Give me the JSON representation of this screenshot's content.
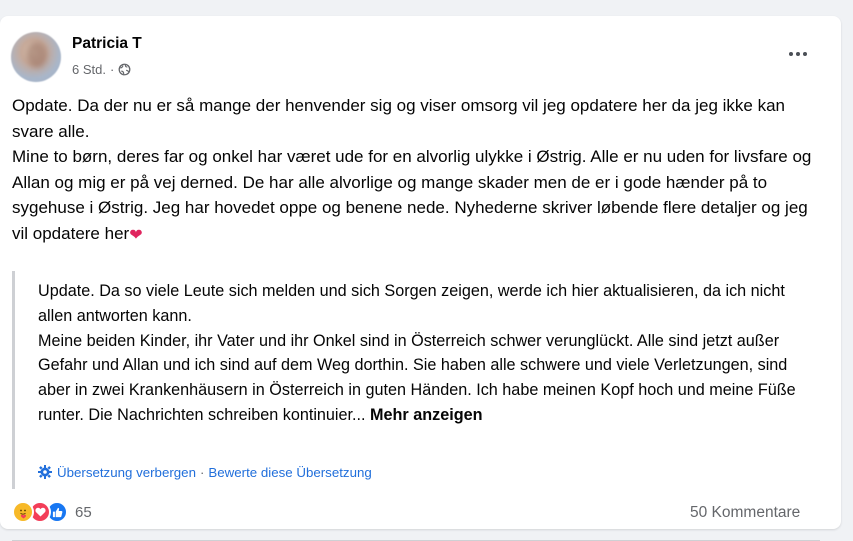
{
  "post": {
    "author": "Patricia T",
    "time": "6 Std.",
    "time_separator": "·",
    "audience_icon": "globe-icon",
    "more_icon": "more-dots-icon",
    "text_lines": [
      "Opdate. Da der nu er så mange der henvender sig og viser omsorg vil jeg opdatere her da jeg ikke kan svare alle.",
      "Mine to børn, deres far og onkel har været ude for en alvorlig ulykke i Østrig. Alle er nu uden for livsfare og Allan og mig er på vej derned. De har alle alvorlige og mange skader men de er i gode hænder på to sygehuse i Østrig. Jeg har hovedet oppe og benene nede. Nyhederne skriver løbende flere detaljer og jeg vil opdatere her"
    ],
    "heart_emoji": "❤"
  },
  "translation": {
    "lines": [
      "Update. Da so viele Leute sich melden und sich Sorgen zeigen, werde ich hier aktualisieren, da ich nicht allen antworten kann.",
      "Meine beiden Kinder, ihr Vater und ihr Onkel sind in Österreich schwer verunglückt. Alle sind jetzt außer Gefahr und Allan und ich sind auf dem Weg dorthin. Sie haben alle schwere und viele Verletzungen, sind aber in zwei Krankenhäusern in Österreich in guten Händen. Ich habe meinen Kopf hoch und meine Füße runter. Die Nachrichten schreiben kontinuier..."
    ],
    "see_more": "Mehr anzeigen",
    "hide_translation": "Übersetzung verbergen",
    "rate_translation": "Bewerte diese Übersetzung",
    "link_separator": "·",
    "link_color": "#216fdb"
  },
  "footer": {
    "reaction_icons": [
      "care-reaction-icon",
      "love-reaction-icon",
      "like-reaction-icon"
    ],
    "reaction_count": "65",
    "comments": "50 Kommentare"
  },
  "colors": {
    "like": "#1877f2",
    "love": "#f33e58",
    "care": "#f7b928",
    "heart": "#e0245e"
  }
}
